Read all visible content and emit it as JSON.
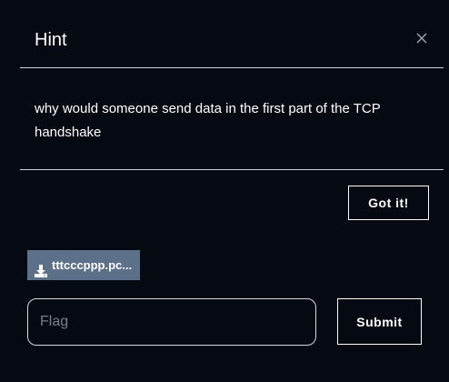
{
  "modal": {
    "title": "Hint",
    "close_icon": "close-icon",
    "hint_text": "why would someone send data in the first part of the TCP handshake",
    "got_it_label": "Got it!"
  },
  "challenge": {
    "file_label": "tttcccppp.pc...",
    "file_icon": "download-icon",
    "flag_placeholder": "Flag",
    "flag_value": "",
    "submit_label": "Submit"
  },
  "colors": {
    "background": "#050a12",
    "file_button": "#5c7089",
    "text": "#ffffff",
    "divider": "#cfd4da"
  }
}
